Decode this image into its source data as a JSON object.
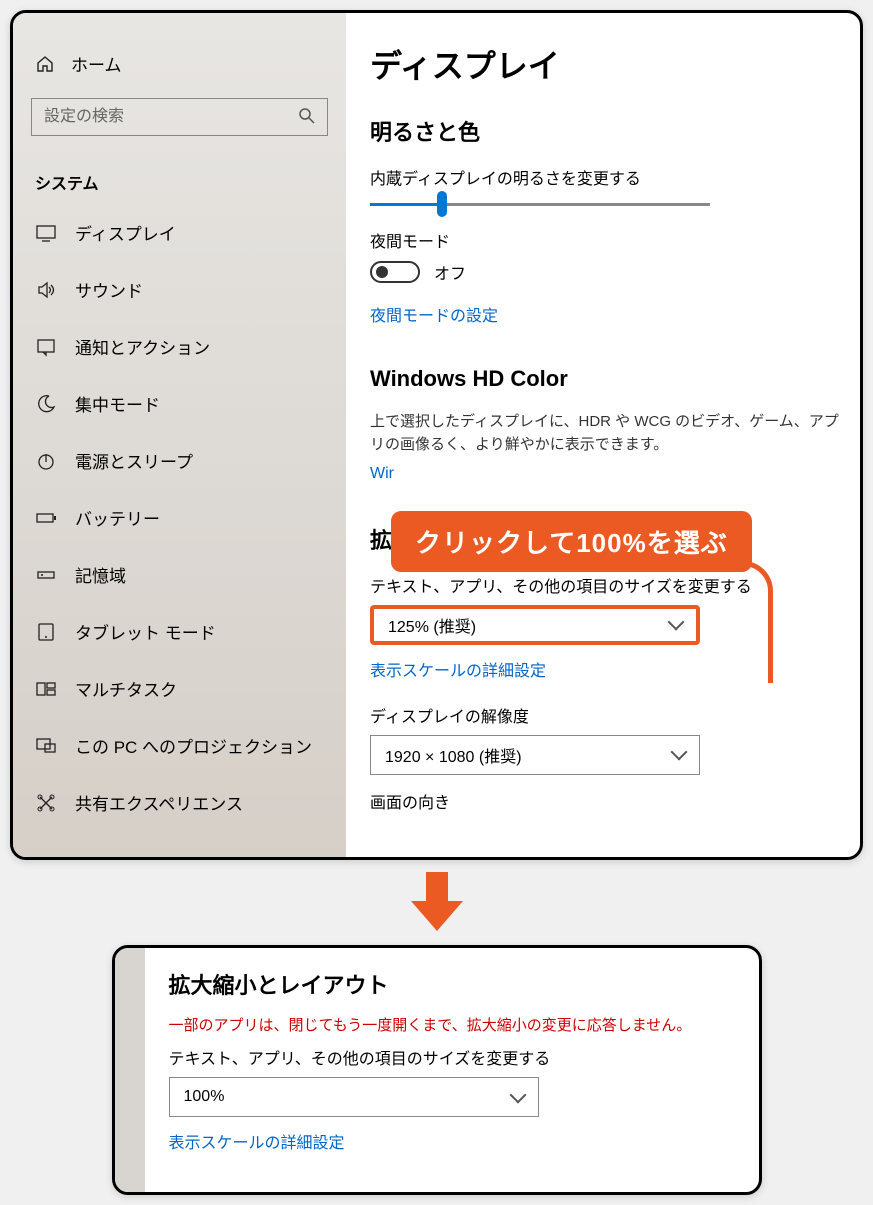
{
  "sidebar": {
    "home": "ホーム",
    "search_placeholder": "設定の検索",
    "section": "システム",
    "items": [
      {
        "label": "ディスプレイ"
      },
      {
        "label": "サウンド"
      },
      {
        "label": "通知とアクション"
      },
      {
        "label": "集中モード"
      },
      {
        "label": "電源とスリープ"
      },
      {
        "label": "バッテリー"
      },
      {
        "label": "記憶域"
      },
      {
        "label": "タブレット モード"
      },
      {
        "label": "マルチタスク"
      },
      {
        "label": "この PC へのプロジェクション"
      },
      {
        "label": "共有エクスペリエンス"
      }
    ]
  },
  "main": {
    "title": "ディスプレイ",
    "brightness_heading": "明るさと色",
    "brightness_label": "内蔵ディスプレイの明るさを変更する",
    "night_mode_label": "夜間モード",
    "night_mode_state": "オフ",
    "night_mode_link": "夜間モードの設定",
    "hd_color_heading": "Windows HD Color",
    "hd_color_desc": "上で選択したディスプレイに、HDR や WCG のビデオ、ゲーム、アプリの画像るく、より鮮やかに表示できます。",
    "hd_color_link_prefix": "Wir",
    "scale_heading": "拡大縮小とレイアウト",
    "scale_label": "テキスト、アプリ、その他の項目のサイズを変更する",
    "scale_value": "125% (推奨)",
    "scale_link": "表示スケールの詳細設定",
    "resolution_label": "ディスプレイの解像度",
    "resolution_value": "1920 × 1080 (推奨)",
    "orientation_label": "画面の向き"
  },
  "callout": "クリックして100%を選ぶ",
  "panel2": {
    "heading": "拡大縮小とレイアウト",
    "warning": "一部のアプリは、閉じてもう一度開くまで、拡大縮小の変更に応答しません。",
    "scale_label": "テキスト、アプリ、その他の項目のサイズを変更する",
    "scale_value": "100%",
    "scale_link": "表示スケールの詳細設定"
  }
}
